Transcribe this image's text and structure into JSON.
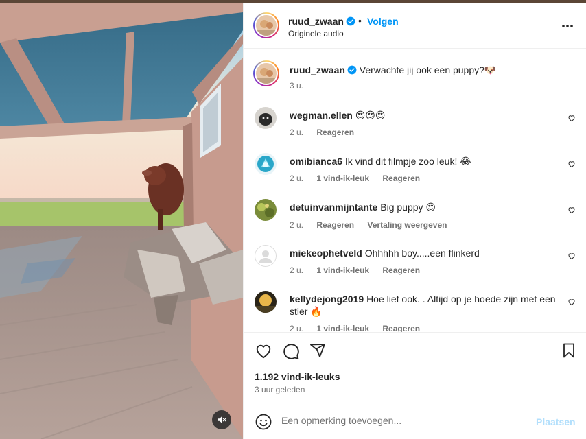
{
  "post": {
    "author": "ruud_zwaan",
    "follow_label": "Volgen",
    "separator": "•",
    "audio": "Originele audio",
    "more_icon": "more-horizontal-icon"
  },
  "caption": {
    "username": "ruud_zwaan",
    "text": "Verwachte jij ook een puppy?🐶",
    "time": "3 u."
  },
  "comments": [
    {
      "username": "wegman.ellen",
      "text": "😍😍😍",
      "time": "2 u.",
      "likes": "",
      "reply": "Reageren",
      "extra": ""
    },
    {
      "username": "omibianca6",
      "text": "Ik vind dit filmpje zoo leuk! 😂",
      "time": "2 u.",
      "likes": "1 vind-ik-leuk",
      "reply": "Reageren",
      "extra": ""
    },
    {
      "username": "detuinvanmijntante",
      "text": "Big puppy 😍",
      "time": "2 u.",
      "likes": "",
      "reply": "Reageren",
      "extra": "Vertaling weergeven"
    },
    {
      "username": "miekeophetveld",
      "text": "Ohhhhh boy.....een flinkerd",
      "time": "2 u.",
      "likes": "1 vind-ik-leuk",
      "reply": "Reageren",
      "extra": ""
    },
    {
      "username": "kellydejong2019",
      "text": "Hoe lief ook. . Altijd op je hoede zijn met een stier 🔥",
      "time": "2 u.",
      "likes": "1 vind-ik-leuk",
      "reply": "Reageren",
      "extra": ""
    }
  ],
  "actions": {
    "likes": "1.192 vind-ik-leuks",
    "ago": "3 uur geleden",
    "icons": [
      "heart-icon",
      "comment-icon",
      "share-icon",
      "bookmark-icon"
    ]
  },
  "add_comment": {
    "placeholder": "Een opmerking toevoegen...",
    "post_label": "Plaatsen"
  },
  "colors": {
    "accent": "#0095f6",
    "verified": "#0095f6",
    "muted": "#737373",
    "post_disabled": "#b2dffc"
  }
}
